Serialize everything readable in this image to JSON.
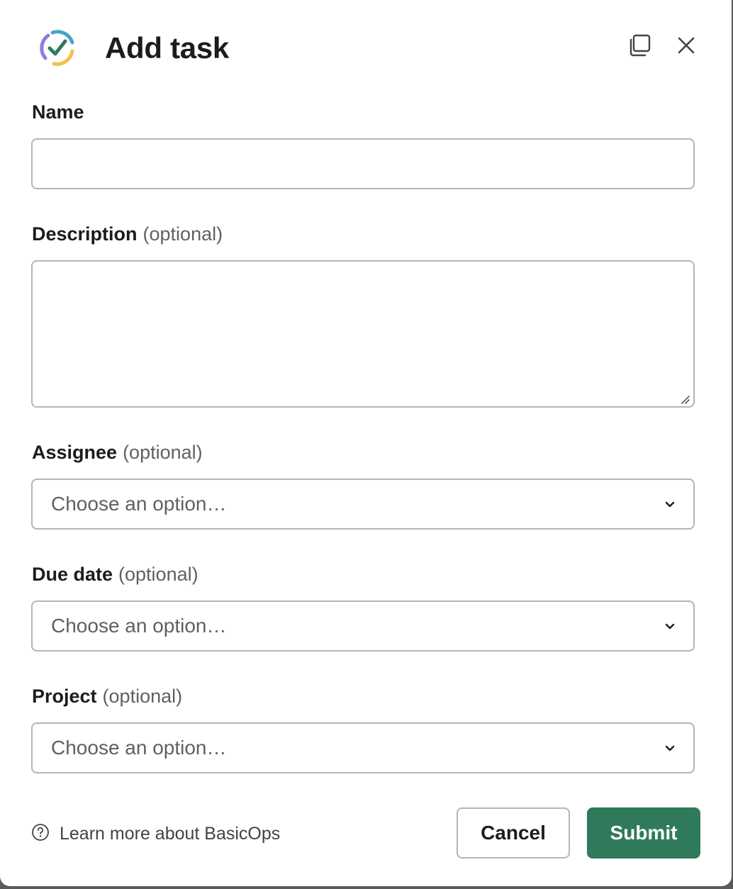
{
  "dialog": {
    "title": "Add task",
    "logo_icon": "basicops-check-logo-icon",
    "expand_icon": "expand-window-icon",
    "close_icon": "close-icon"
  },
  "fields": {
    "name": {
      "label": "Name",
      "value": "",
      "placeholder": ""
    },
    "description": {
      "label": "Description",
      "optional_text": "(optional)",
      "value": "",
      "placeholder": ""
    },
    "assignee": {
      "label": "Assignee",
      "optional_text": "(optional)",
      "placeholder": "Choose an option…"
    },
    "due_date": {
      "label": "Due date",
      "optional_text": "(optional)",
      "placeholder": "Choose an option…"
    },
    "project": {
      "label": "Project",
      "optional_text": "(optional)",
      "placeholder": "Choose an option…"
    }
  },
  "footer": {
    "help_icon": "question-circle-icon",
    "help_link": "Learn more about BasicOps",
    "cancel_label": "Cancel",
    "submit_label": "Submit"
  },
  "colors": {
    "submit_bg": "#2f7a5a",
    "border": "#b5b5b5",
    "text": "#1d1c1d",
    "muted_text": "#616061"
  }
}
